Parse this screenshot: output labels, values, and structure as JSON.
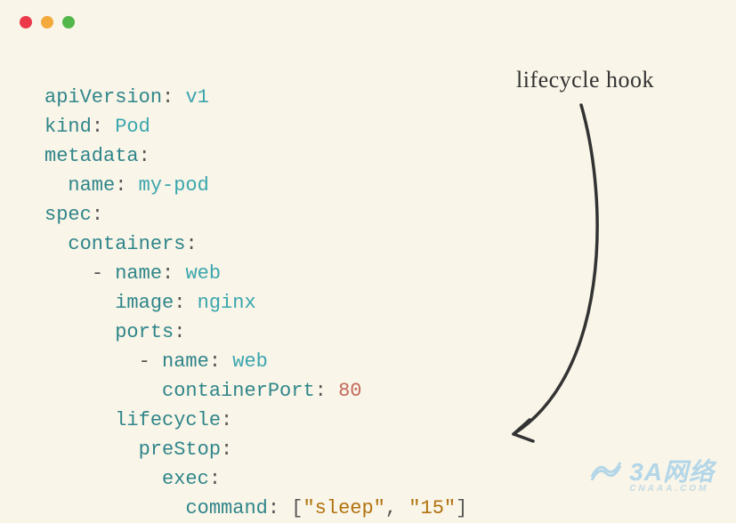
{
  "window": {
    "dots": [
      "red",
      "yellow",
      "green"
    ]
  },
  "annotation": "lifecycle hook",
  "yaml": {
    "l1": {
      "k": "apiVersion",
      "v": "v1"
    },
    "l2": {
      "k": "kind",
      "v": "Pod"
    },
    "l3": {
      "k": "metadata"
    },
    "l4": {
      "k": "name",
      "v": "my-pod"
    },
    "l5": {
      "k": "spec"
    },
    "l6": {
      "k": "containers"
    },
    "l7": {
      "k": "name",
      "v": "web"
    },
    "l8": {
      "k": "image",
      "v": "nginx"
    },
    "l9": {
      "k": "ports"
    },
    "l10": {
      "k": "name",
      "v": "web"
    },
    "l11": {
      "k": "containerPort",
      "v": "80"
    },
    "l12": {
      "k": "lifecycle"
    },
    "l13": {
      "k": "preStop"
    },
    "l14": {
      "k": "exec"
    },
    "l15": {
      "k": "command",
      "a": "\"sleep\"",
      "b": "\"15\""
    }
  },
  "watermark": {
    "main": "3A网络",
    "sub": "CNAAA.COM"
  }
}
